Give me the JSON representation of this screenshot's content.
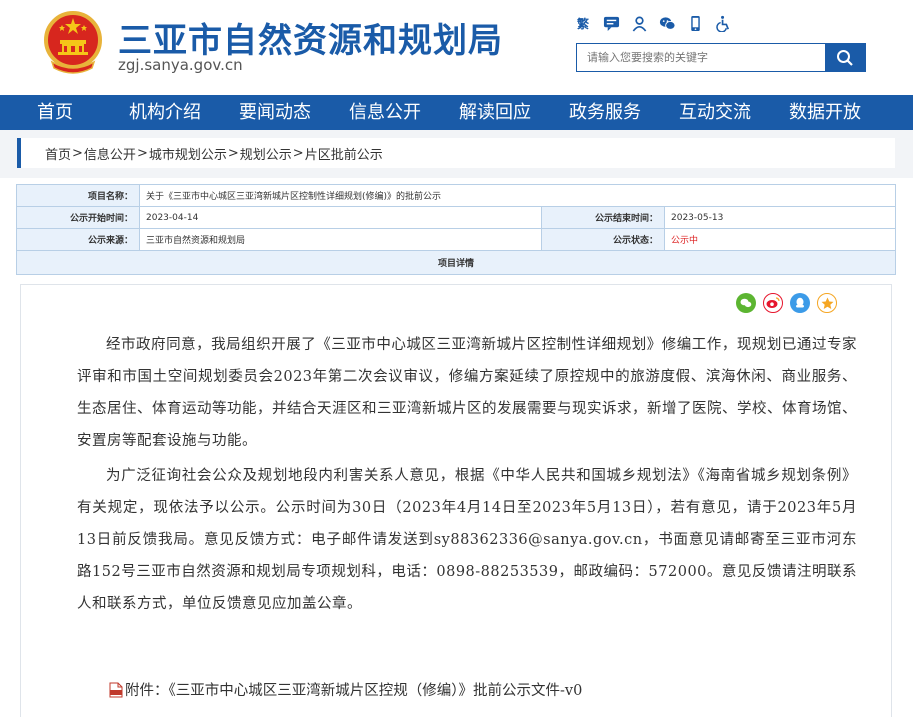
{
  "header": {
    "site_title": "三亚市自然资源和规划局",
    "domain": "zgj.sanya.gov.cn",
    "search_placeholder": "请输入您要搜索的关键字",
    "tools": [
      {
        "label": "繁",
        "icon": "traditional-chinese-icon"
      },
      {
        "icon": "chat-bubble-icon"
      },
      {
        "icon": "user-icon"
      },
      {
        "icon": "wechat-icon"
      },
      {
        "icon": "mobile-icon"
      },
      {
        "icon": "accessibility-icon"
      }
    ]
  },
  "nav": [
    "首页",
    "机构介绍",
    "要闻动态",
    "信息公开",
    "解读回应",
    "政务服务",
    "互动交流",
    "数据开放"
  ],
  "breadcrumb": [
    "首页",
    "信息公开",
    "城市规划公示",
    "规划公示",
    "片区批前公示"
  ],
  "info": {
    "project_name_label": "项目名称：",
    "project_name": "关于《三亚市中心城区三亚湾新城片区控制性详细规划(修编)》的批前公示",
    "start_label": "公示开始时间：",
    "start": "2023-04-14",
    "end_label": "公示结束时间：",
    "end": "2023-05-13",
    "source_label": "公示来源：",
    "source": "三亚市自然资源和规划局",
    "status_label": "公示状态：",
    "status": "公示中",
    "detail_header": "项目详情"
  },
  "colors": {
    "brand": "#1a5ba8",
    "status": "#dd2222"
  },
  "article": {
    "paragraphs": [
      "经市政府同意，我局组织开展了《三亚市中心城区三亚湾新城片区控制性详细规划》修编工作，现规划已通过专家评审和市国土空间规划委员会2023年第二次会议审议，修编方案延续了原控规中的旅游度假、滨海休闲、商业服务、生态居住、体育运动等功能，并结合天涯区和三亚湾新城片区的发展需要与现实诉求，新增了医院、学校、体育场馆、安置房等配套设施与功能。",
      "为广泛征询社会公众及规划地段内利害关系人意见，根据《中华人民共和国城乡规划法》《海南省城乡规划条例》有关规定，现依法予以公示。公示时间为30日（2023年4月14日至2023年5月13日），若有意见，请于2023年5月13日前反馈我局。意见反馈方式：电子邮件请发送到sy88362336@sanya.gov.cn，书面意见请邮寄至三亚市河东路152号三亚市自然资源和规划局专项规划科，电话：0898-88253539，邮政编码：572000。意见反馈请注明联系人和联系方式，单位反馈意见应加盖公章。"
    ],
    "attachment": "附件：《三亚市中心城区三亚湾新城片区控规（修编）》批前公示文件-v0"
  }
}
